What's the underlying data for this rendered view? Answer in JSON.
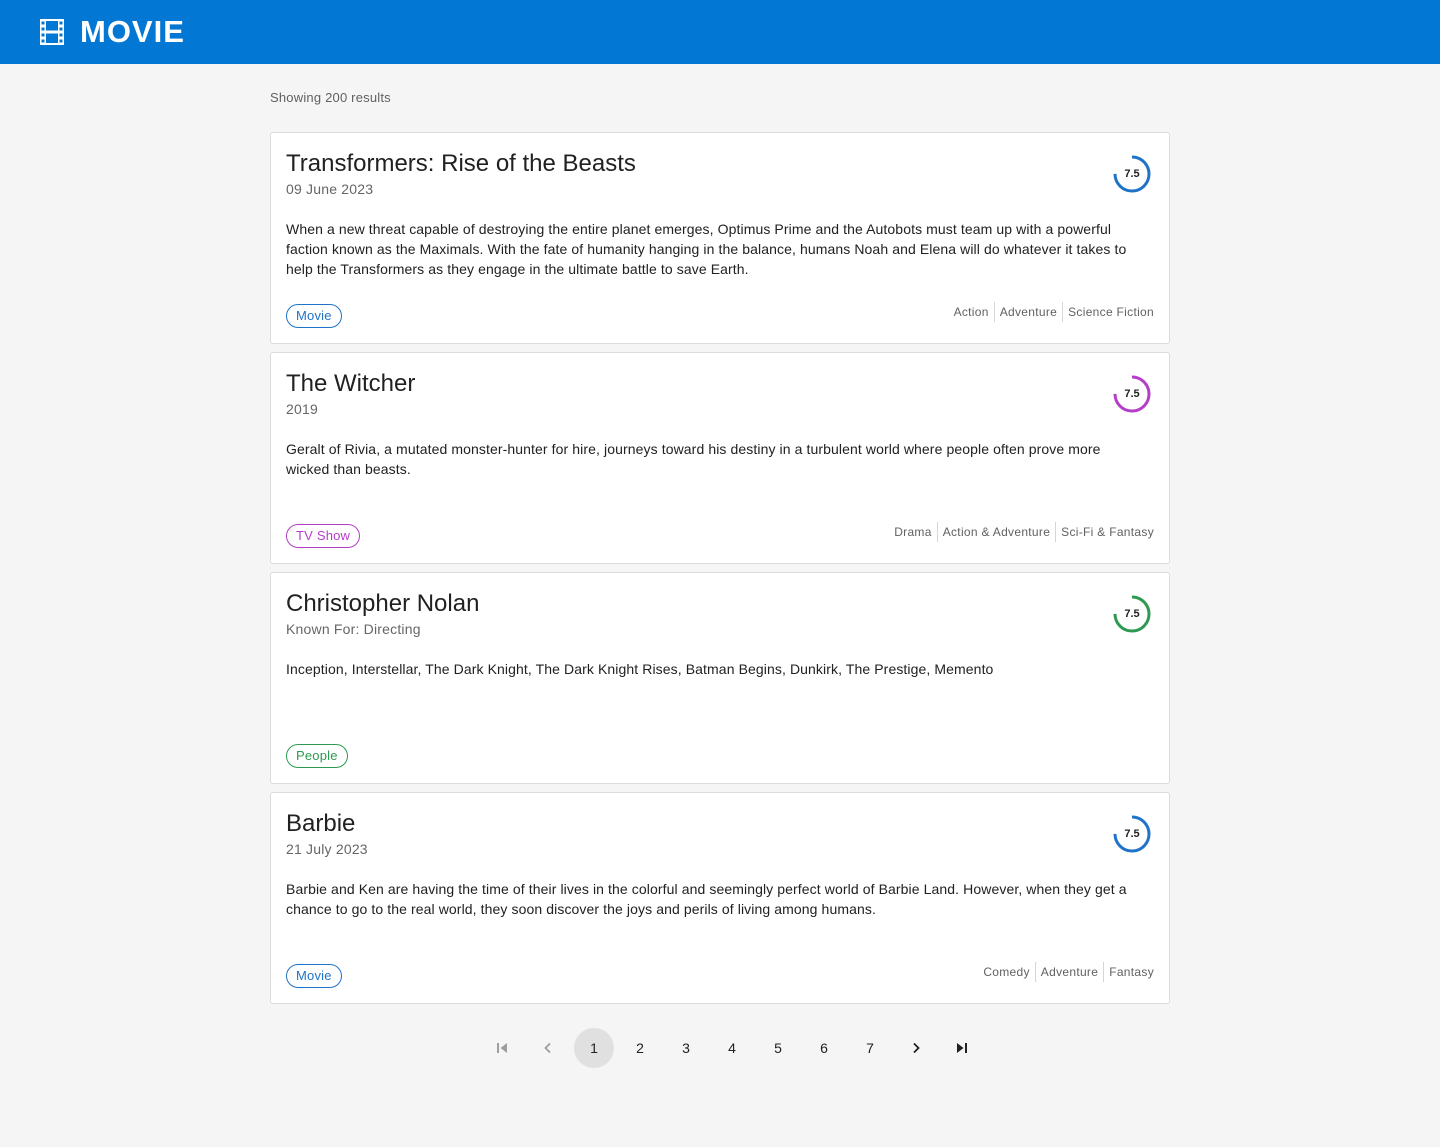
{
  "app": {
    "title": "MOVIE",
    "brand_icon": "film-icon"
  },
  "results": {
    "text": "Showing 200 results"
  },
  "cards": [
    {
      "title": "Transformers: Rise of the Beasts",
      "subtitle": "09 June 2023",
      "description": "When a new threat capable of destroying the entire planet emerges, Optimus Prime and the Autobots must team up with a powerful faction known as the Maximals. With the fate of humanity hanging in the balance, humans Noah and Elena will do whatever it takes to help the Transformers as they engage in the ultimate battle to save Earth.",
      "rating": "7.5",
      "rating_fraction": 0.75,
      "rating_color": "#1e73c8",
      "type_label": "Movie",
      "genres": [
        "Action",
        "Adventure",
        "Science Fiction"
      ]
    },
    {
      "title": "The Witcher",
      "subtitle": "2019",
      "description": "Geralt of Rivia, a mutated monster-hunter for hire, journeys toward his destiny in a turbulent world where people often prove more wicked than beasts.",
      "rating": "7.5",
      "rating_fraction": 0.75,
      "rating_color": "#b43ec8",
      "type_label": "TV Show",
      "genres": [
        "Drama",
        "Action & Adventure",
        "Sci-Fi & Fantasy"
      ]
    },
    {
      "title": "Christopher Nolan",
      "subtitle": "Known For: Directing",
      "description": "Inception, Interstellar, The Dark Knight, The Dark Knight Rises, Batman Begins, Dunkirk, The Prestige, Memento",
      "rating": "7.5",
      "rating_fraction": 0.75,
      "rating_color": "#2e9950",
      "type_label": "People",
      "genres": []
    },
    {
      "title": "Barbie",
      "subtitle": "21 July 2023",
      "description": "Barbie and Ken are having the time of their lives in the colorful and seemingly perfect world of Barbie Land. However, when they get a chance to go to the real world, they soon discover the joys and perils of living among humans.",
      "rating": "7.5",
      "rating_fraction": 0.75,
      "rating_color": "#1e73c8",
      "type_label": "Movie",
      "genres": [
        "Comedy",
        "Adventure",
        "Fantasy"
      ]
    }
  ],
  "pagination": {
    "pages": [
      "1",
      "2",
      "3",
      "4",
      "5",
      "6",
      "7"
    ],
    "current": "1",
    "icons": [
      "first-page-icon",
      "chevron-left-icon",
      "chevron-right-icon",
      "last-page-icon"
    ]
  },
  "colors": {
    "appbar": "#0277d4",
    "movie": "#1e73c8",
    "tv": "#b43ec8",
    "people": "#2e9950"
  }
}
